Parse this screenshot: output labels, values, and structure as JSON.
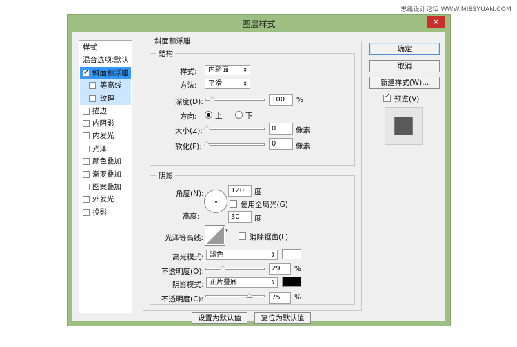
{
  "watermark": "思缘设计论坛 WWW.MISSYUAN.COM",
  "dialog": {
    "title": "图层样式",
    "close_label": "✕"
  },
  "colors": {
    "frame": "#9dbf82",
    "selection": "#3399ff",
    "close": "#c9302c"
  },
  "left_panel": {
    "header": "样式",
    "blend_default": "混合选项:默认",
    "items": [
      {
        "label": "斜面和浮雕",
        "checked": true
      },
      {
        "label": "等高线",
        "checked": false
      },
      {
        "label": "纹理",
        "checked": false
      },
      {
        "label": "描边",
        "checked": false
      },
      {
        "label": "内阴影",
        "checked": false
      },
      {
        "label": "内发光",
        "checked": false
      },
      {
        "label": "光泽",
        "checked": false
      },
      {
        "label": "颜色叠加",
        "checked": false
      },
      {
        "label": "渐变叠加",
        "checked": false
      },
      {
        "label": "图案叠加",
        "checked": false
      },
      {
        "label": "外发光",
        "checked": false
      },
      {
        "label": "投影",
        "checked": false
      }
    ]
  },
  "bevel": {
    "group_title": "斜面和浮雕",
    "structure_title": "结构",
    "style_label": "样式:",
    "style_value": "内斜面",
    "technique_label": "方法:",
    "technique_value": "平滑",
    "depth_label": "深度(D):",
    "depth_value": "100",
    "depth_unit": "%",
    "depth_level": 0.1,
    "direction_label": "方向:",
    "direction_up": "上",
    "direction_down": "下",
    "size_label": "大小(Z):",
    "size_value": "0",
    "size_unit": "像素",
    "size_level": 0,
    "soften_label": "软化(F):",
    "soften_value": "0",
    "soften_unit": "像素",
    "soften_level": 0
  },
  "shading": {
    "title": "阴影",
    "angle_label": "角度(N):",
    "angle_value": "120",
    "angle_unit": "度",
    "global_light_label": "使用全局光(G)",
    "altitude_label": "高度:",
    "altitude_value": "30",
    "altitude_unit": "度",
    "gloss_label": "光泽等高线:",
    "antialias_label": "消除锯齿(L)",
    "highlight_mode_label": "高光模式:",
    "highlight_mode_value": "滤色",
    "highlight_color": "#ffffff",
    "highlight_opacity_label": "不透明度(O):",
    "highlight_opacity_value": "29",
    "highlight_opacity_unit": "%",
    "highlight_opacity_level": 0.29,
    "shadow_mode_label": "阴影模式:",
    "shadow_mode_value": "正片叠底",
    "shadow_color": "#000000",
    "shadow_opacity_label": "不透明度(C):",
    "shadow_opacity_value": "75",
    "shadow_opacity_unit": "%",
    "shadow_opacity_level": 0.75
  },
  "bottom_buttons": {
    "make_default": "设置为默认值",
    "reset_default": "复位为默认值"
  },
  "right_panel": {
    "ok": "确定",
    "cancel": "取消",
    "new_style": "新建样式(W)...",
    "preview_label": "预览(V)"
  }
}
